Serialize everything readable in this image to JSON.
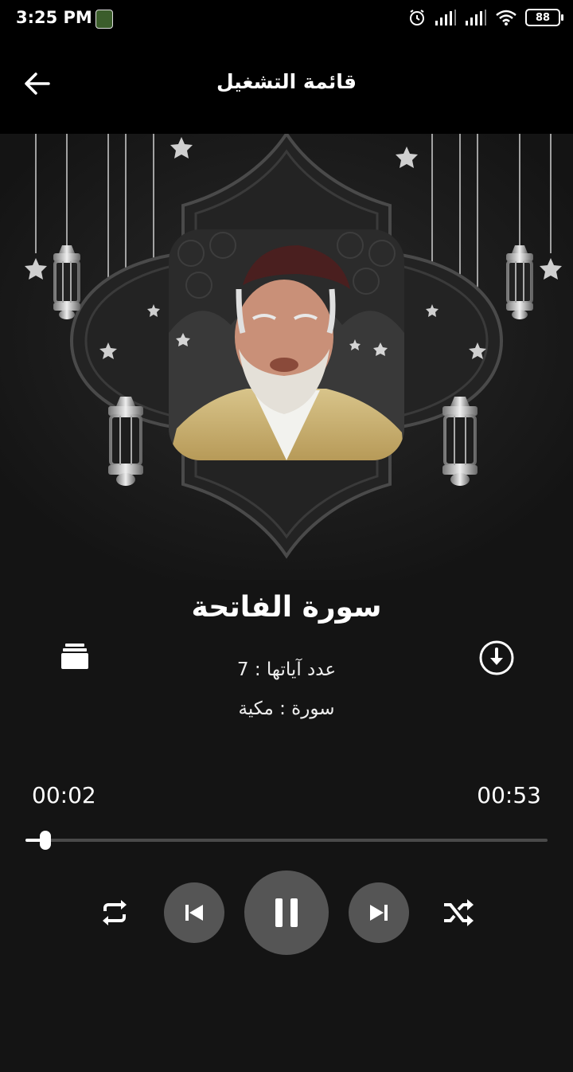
{
  "status_bar": {
    "time": "3:25 PM",
    "icons": [
      "app-notification-icon",
      "alarm-icon",
      "signal-icon",
      "signal-icon",
      "wifi-icon",
      "battery-icon"
    ],
    "battery_level": "88"
  },
  "toolbar": {
    "title": "قائمة التشغيل",
    "back_icon": "arrow-left-icon"
  },
  "track": {
    "title": "سورة الفاتحة",
    "ayah_count_label": "عدد آياتها : 7",
    "surah_type_label": "سورة : مكية"
  },
  "player": {
    "elapsed": "00:02",
    "total": "00:53",
    "progress": 0.038,
    "state": "playing"
  },
  "controls": [
    "repeat-icon",
    "previous-icon",
    "pause-icon",
    "next-icon",
    "shuffle-icon"
  ],
  "actions": [
    "playlist-icon",
    "download-icon"
  ],
  "colors": {
    "background": "#141414",
    "bar": "#000000",
    "control_circle": "#555555",
    "seek_track": "#4a4a4a",
    "accent": "#ffffff"
  }
}
